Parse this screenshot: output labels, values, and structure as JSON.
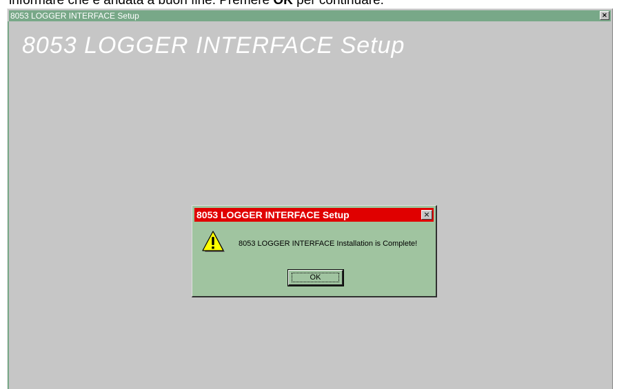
{
  "caption": {
    "text_before": "informare che è andata a buon fine. Premere ",
    "bold": "OK",
    "text_after": " per continuare."
  },
  "main_window": {
    "title": "8053 LOGGER INTERFACE Setup",
    "close_glyph": "×",
    "banner": "8053 LOGGER INTERFACE Setup",
    "titlebar_color": "#78a888",
    "background_color": "#c6c6c6"
  },
  "dialog": {
    "title": "8053 LOGGER INTERFACE Setup",
    "close_glyph": "×",
    "icon": "warning-icon",
    "message": "8053 LOGGER INTERFACE Installation is Complete!",
    "ok_label": "OK",
    "titlebar_color": "#e00000",
    "background_color": "#a0c4a0"
  }
}
